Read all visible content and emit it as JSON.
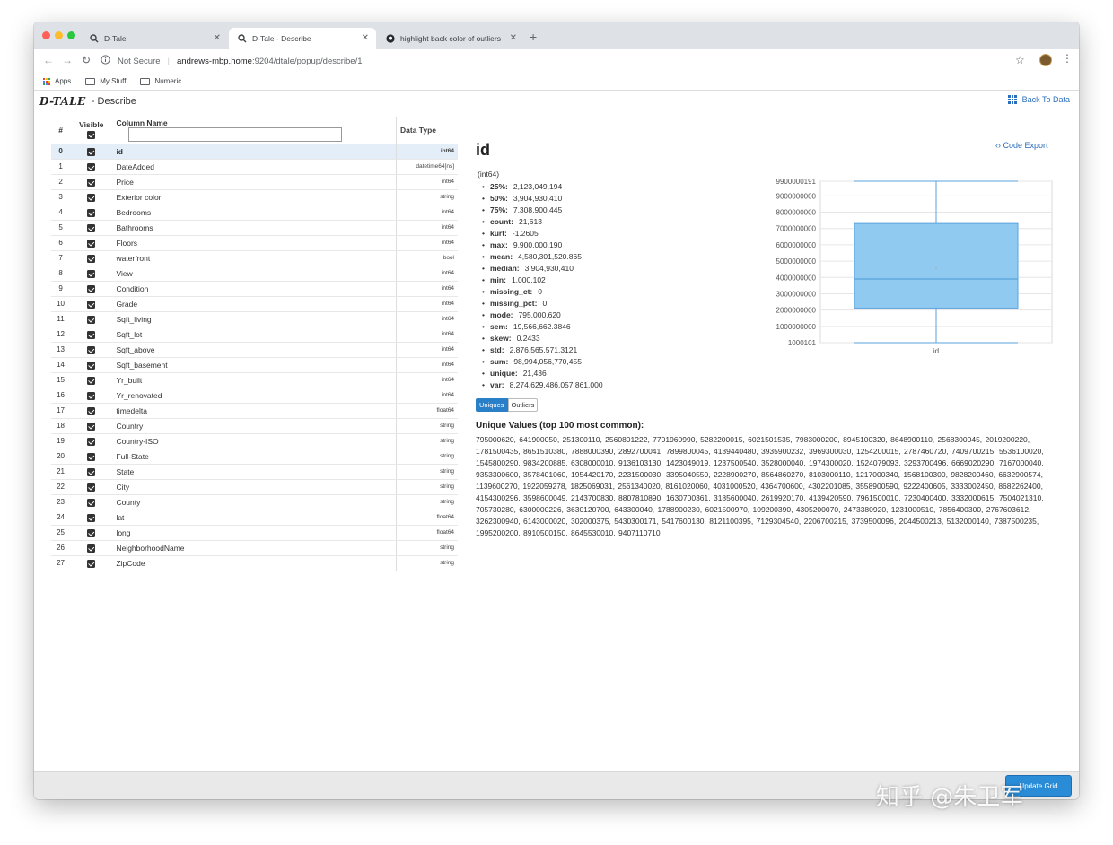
{
  "browser": {
    "tabs": [
      {
        "title": "D-Tale",
        "active": false
      },
      {
        "title": "D-Tale - Describe",
        "active": true
      },
      {
        "title": "highlight back color of outliers",
        "active": false
      }
    ],
    "new_tab": "+",
    "security_label": "Not Secure",
    "url_host": "andrews-mbp.home",
    "url_path": ":9204/dtale/popup/describe/1",
    "bookmarks": [
      {
        "label": "Apps",
        "icon": "apps-grid-icon"
      },
      {
        "label": "My Stuff",
        "icon": "folder-icon"
      },
      {
        "label": "Numeric",
        "icon": "folder-icon"
      }
    ],
    "colors": {
      "tabbar": "#dee1e6",
      "close": "#ff5f57",
      "minimize": "#febc2e",
      "zoom": "#28c840"
    }
  },
  "app": {
    "logo": "D-TALE",
    "page_title": "- Describe",
    "back_to_data": "Back To Data",
    "code_export": "Code Export",
    "accent": "#2a6ebb"
  },
  "columns_table": {
    "headers": {
      "index": "#",
      "visible": "Visible",
      "name": "Column Name",
      "dtype": "Data Type"
    },
    "filter_value": "",
    "rows": [
      {
        "idx": "0",
        "name": "id",
        "dtype": "int64"
      },
      {
        "idx": "1",
        "name": "DateAdded",
        "dtype": "datetime64[ns]"
      },
      {
        "idx": "2",
        "name": "Price",
        "dtype": "int64"
      },
      {
        "idx": "3",
        "name": "Exterior color",
        "dtype": "string"
      },
      {
        "idx": "4",
        "name": "Bedrooms",
        "dtype": "int64"
      },
      {
        "idx": "5",
        "name": "Bathrooms",
        "dtype": "int64"
      },
      {
        "idx": "6",
        "name": "Floors",
        "dtype": "int64"
      },
      {
        "idx": "7",
        "name": "waterfront",
        "dtype": "bool"
      },
      {
        "idx": "8",
        "name": "View",
        "dtype": "int64"
      },
      {
        "idx": "9",
        "name": "Condition",
        "dtype": "int64"
      },
      {
        "idx": "10",
        "name": "Grade",
        "dtype": "int64"
      },
      {
        "idx": "11",
        "name": "Sqft_living",
        "dtype": "int64"
      },
      {
        "idx": "12",
        "name": "Sqft_lot",
        "dtype": "int64"
      },
      {
        "idx": "13",
        "name": "Sqft_above",
        "dtype": "int64"
      },
      {
        "idx": "14",
        "name": "Sqft_basement",
        "dtype": "int64"
      },
      {
        "idx": "15",
        "name": "Yr_built",
        "dtype": "int64"
      },
      {
        "idx": "16",
        "name": "Yr_renovated",
        "dtype": "int64"
      },
      {
        "idx": "17",
        "name": "timedelta",
        "dtype": "float64"
      },
      {
        "idx": "18",
        "name": "Country",
        "dtype": "string"
      },
      {
        "idx": "19",
        "name": "Country-ISO",
        "dtype": "string"
      },
      {
        "idx": "20",
        "name": "Full-State",
        "dtype": "string"
      },
      {
        "idx": "21",
        "name": "State",
        "dtype": "string"
      },
      {
        "idx": "22",
        "name": "City",
        "dtype": "string"
      },
      {
        "idx": "23",
        "name": "County",
        "dtype": "string"
      },
      {
        "idx": "24",
        "name": "lat",
        "dtype": "float64"
      },
      {
        "idx": "25",
        "name": "long",
        "dtype": "float64"
      },
      {
        "idx": "26",
        "name": "NeighborhoodName",
        "dtype": "string"
      },
      {
        "idx": "27",
        "name": "ZipCode",
        "dtype": "string"
      }
    ]
  },
  "details": {
    "column": "id",
    "dtype_label": "(int64)",
    "stats": [
      {
        "key": "25%:",
        "value": "2,123,049,194"
      },
      {
        "key": "50%:",
        "value": "3,904,930,410"
      },
      {
        "key": "75%:",
        "value": "7,308,900,445"
      },
      {
        "key": "count:",
        "value": "21,613"
      },
      {
        "key": "kurt:",
        "value": "-1.2605"
      },
      {
        "key": "max:",
        "value": "9,900,000,190"
      },
      {
        "key": "mean:",
        "value": "4,580,301,520.865"
      },
      {
        "key": "median:",
        "value": "3,904,930,410"
      },
      {
        "key": "min:",
        "value": "1,000,102"
      },
      {
        "key": "missing_ct:",
        "value": "0"
      },
      {
        "key": "missing_pct:",
        "value": "0"
      },
      {
        "key": "mode:",
        "value": "795,000,620"
      },
      {
        "key": "sem:",
        "value": "19,566,662.3846"
      },
      {
        "key": "skew:",
        "value": "0.2433"
      },
      {
        "key": "std:",
        "value": "2,876,565,571.3121"
      },
      {
        "key": "sum:",
        "value": "98,994,056,770,455"
      },
      {
        "key": "unique:",
        "value": "21,436"
      },
      {
        "key": "var:",
        "value": "8,274,629,486,057,861,000"
      }
    ],
    "tab_uniques": "Uniques",
    "tab_outliers": "Outliers",
    "unique_title": "Unique Values (top 100 most common):",
    "unique_values": "795000620, 641900050, 251300110, 2560801222, 7701960990, 5282200015, 6021501535, 7983000200, 8945100320, 8648900110, 2568300045, 2019200220, 1781500435, 8651510380, 7888000390, 2892700041, 7899800045, 4139440480, 3935900232, 3969300030, 1254200015, 2787460720, 7409700215, 5536100020, 1545800290, 9834200885, 6308000010, 9136103130, 1423049019, 1237500540, 3528000040, 1974300020, 1524079093, 3293700496, 6669020290, 7167000040, 9353300600, 3578401060, 1954420170, 2231500030, 3395040550, 2228900270, 8564860270, 8103000110, 1217000340, 1568100300, 9828200460, 6632900574, 1139600270, 1922059278, 1825069031, 2561340020, 8161020060, 4031000520, 4364700600, 4302201085, 3558900590, 9222400605, 3333002450, 8682262400, 4154300296, 3598600049, 2143700830, 8807810890, 1630700361, 3185600040, 2619920170, 4139420590, 7961500010, 7230400400, 3332000615, 7504021310, 705730280, 6300000226, 3630120700, 643300040, 1788900230, 6021500970, 109200390, 4305200070, 2473380920, 1231000510, 7856400300, 2767603612, 3262300940, 6143000020, 302000375, 5430300171, 5417600130, 8121100395, 7129304540, 2206700215, 3739500096, 2044500213, 5132000140, 7387500235, 1995200200, 8910500150, 8645530010, 9407110710"
  },
  "chart_data": {
    "type": "box",
    "categories": [
      "id"
    ],
    "yticks": [
      "9900000191",
      "9000000000",
      "8000000000",
      "7000000000",
      "6000000000",
      "5000000000",
      "4000000000",
      "3000000000",
      "2000000000",
      "1000000000",
      "1000101"
    ],
    "ylim": [
      1000101,
      9900000191
    ],
    "series": [
      {
        "min": 1000102,
        "q1": 2123049194,
        "median": 3904930410,
        "q3": 7308900445,
        "max": 9900000190,
        "mean": 4580301520.865
      }
    ],
    "box_color": "#90caf0",
    "line_color": "#5aa3dd"
  },
  "footer": {
    "update_button": "Update Grid"
  },
  "watermark": "知乎 @朱卫军"
}
